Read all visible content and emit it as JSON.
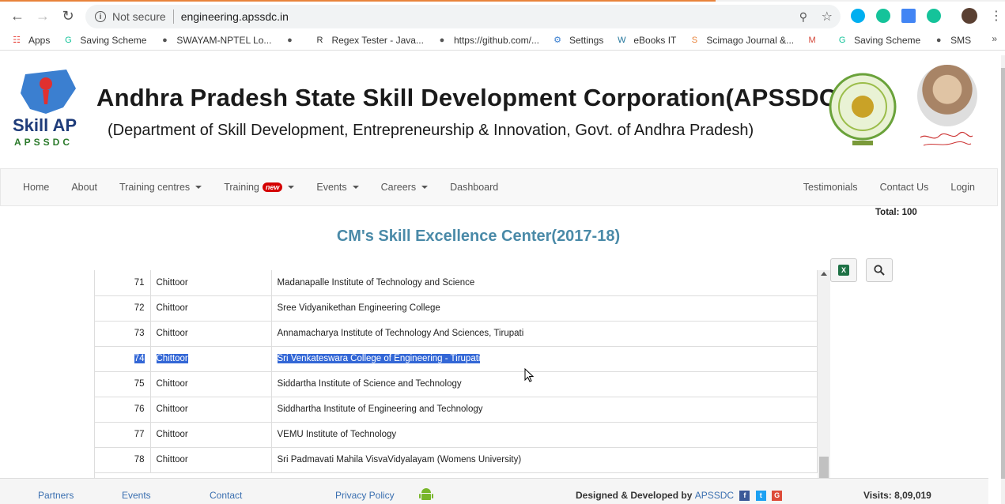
{
  "browser": {
    "security_label": "Not secure",
    "url": "engineering.apssdc.in",
    "bookmarks": [
      {
        "label": "Apps",
        "icon": "apps-grid-icon"
      },
      {
        "label": "Saving Scheme",
        "icon": "g-icon"
      },
      {
        "label": "SWAYAM-NPTEL Lo...",
        "icon": "globe-icon"
      },
      {
        "label": "",
        "icon": "globe-icon"
      },
      {
        "label": "Regex Tester - Java...",
        "icon": "regex-icon"
      },
      {
        "label": "https://github.com/...",
        "icon": "globe-icon"
      },
      {
        "label": "Settings",
        "icon": "gear-icon"
      },
      {
        "label": "eBooks IT",
        "icon": "wordpress-icon"
      },
      {
        "label": "Scimago Journal &...",
        "icon": "sjr-icon"
      },
      {
        "label": "",
        "icon": "gmail-icon"
      },
      {
        "label": "Saving Scheme",
        "icon": "g-icon"
      },
      {
        "label": "SMS",
        "icon": "globe-icon"
      }
    ]
  },
  "header": {
    "logo_text": "Skill AP",
    "logo_sub": "APSSDC",
    "title": "Andhra Pradesh State Skill Development Corporation(APSSDC)",
    "subtitle": "(Department of Skill Development, Entrepreneurship & Innovation, Govt. of Andhra Pradesh)"
  },
  "nav": {
    "left": [
      {
        "label": "Home",
        "dropdown": false
      },
      {
        "label": "About",
        "dropdown": false
      },
      {
        "label": "Training centres",
        "dropdown": true
      },
      {
        "label": "Training",
        "dropdown": true,
        "badge": "new"
      },
      {
        "label": "Events",
        "dropdown": true
      },
      {
        "label": "Careers",
        "dropdown": true
      },
      {
        "label": "Dashboard",
        "dropdown": false
      }
    ],
    "right": [
      "Testimonials",
      "Contact Us",
      "Login"
    ]
  },
  "total_label": "Total: 100",
  "section_title": "CM's Skill Excellence Center(2017-18)",
  "table": {
    "rows": [
      {
        "sno": "71",
        "district": "Chittoor",
        "college": "Madanapalle Institute of Technology and Science",
        "selected": false
      },
      {
        "sno": "72",
        "district": "Chittoor",
        "college": "Sree Vidyanikethan Engineering College",
        "selected": false
      },
      {
        "sno": "73",
        "district": "Chittoor",
        "college": "Annamacharya Institute of Technology And Sciences, Tirupati",
        "selected": false
      },
      {
        "sno": "74",
        "district": "Chittoor",
        "college": "Sri Venkateswara College of Engineering - Tirupati",
        "selected": true
      },
      {
        "sno": "75",
        "district": "Chittoor",
        "college": "Siddartha Institute of Science and Technology",
        "selected": false
      },
      {
        "sno": "76",
        "district": "Chittoor",
        "college": "Siddhartha Institute of Engineering and Technology",
        "selected": false
      },
      {
        "sno": "77",
        "district": "Chittoor",
        "college": "VEMU Institute of Technology",
        "selected": false
      },
      {
        "sno": "78",
        "district": "Chittoor",
        "college": "Sri Padmavati Mahila VisvaVidyalayam (Womens University)",
        "selected": false
      }
    ]
  },
  "footer": {
    "links": [
      "Partners",
      "Events",
      "Contact",
      "Privacy Policy"
    ],
    "designed_prefix": "Designed & Developed by",
    "designed_brand": "APSSDC",
    "visits": "Visits: 8,09,019"
  }
}
